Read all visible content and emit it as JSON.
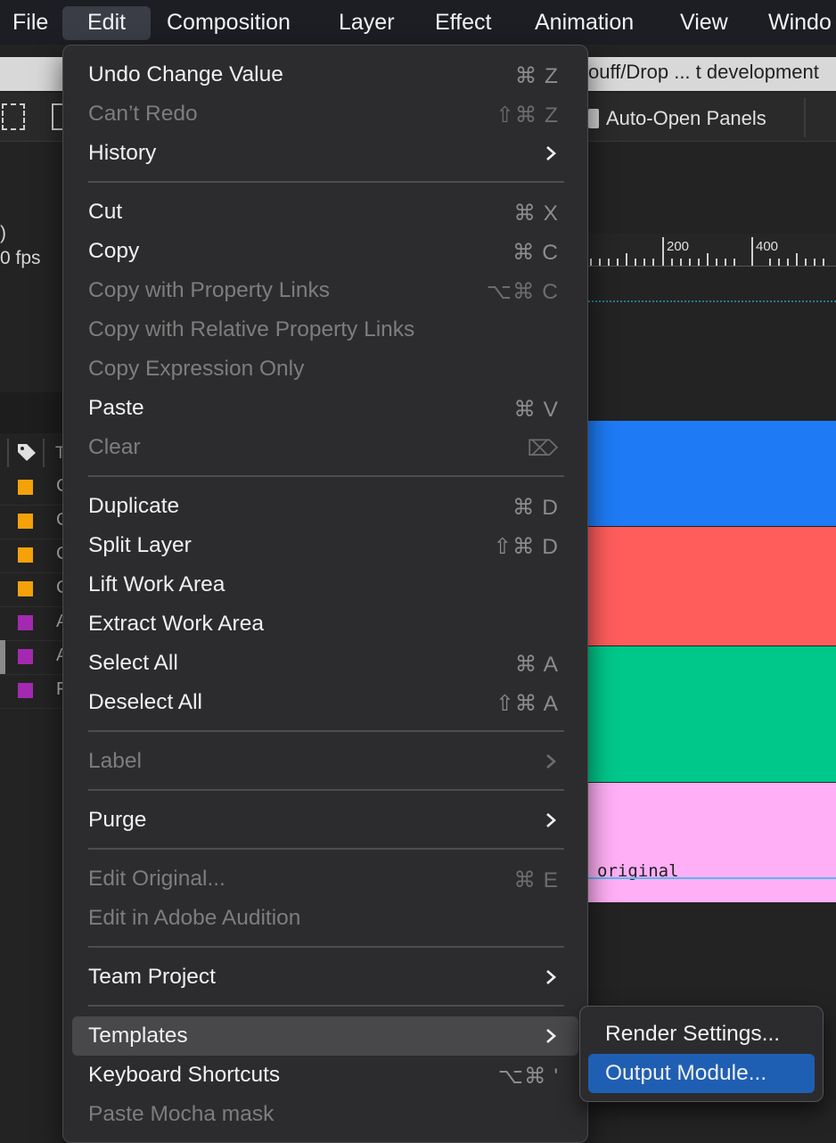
{
  "menubar": {
    "items": [
      "File",
      "Edit",
      "Composition",
      "Layer",
      "Effect",
      "Animation",
      "View",
      "Windo"
    ],
    "active": "Edit"
  },
  "tab": {
    "path": "ouff/Drop ... t development"
  },
  "toolbar": {
    "auto_open_label": "Auto-Open Panels"
  },
  "info": {
    "line1": ")",
    "line2": "0 fps"
  },
  "ruler": {
    "labels": [
      "200",
      "400"
    ]
  },
  "layers": {
    "rows": [
      {
        "color": "#f5a20a",
        "text": "C"
      },
      {
        "color": "#f5a20a",
        "text": "C"
      },
      {
        "color": "#f5a20a",
        "text": "C"
      },
      {
        "color": "#f5a20a",
        "text": "C"
      },
      {
        "color": "#a32ab0",
        "text": "A"
      },
      {
        "color": "#a32ab0",
        "text": "A"
      },
      {
        "color": "#a32ab0",
        "text": "F"
      }
    ],
    "col_header": "T"
  },
  "timeline": {
    "bar_colors": [
      "#1e7bf5",
      "#ff5c5c",
      "#00c78a",
      "#ffaff5"
    ],
    "original_text": "original"
  },
  "edit_menu": {
    "items": [
      {
        "label": "Undo Change Value",
        "shortcut": "⌘ Z",
        "enabled": true
      },
      {
        "label": "Can’t Redo",
        "shortcut": "⇧⌘ Z",
        "enabled": false
      },
      {
        "label": "History",
        "submenu": true,
        "enabled": true
      },
      {
        "label": "Cut",
        "shortcut": "⌘ X",
        "enabled": true
      },
      {
        "label": "Copy",
        "shortcut": "⌘ C",
        "enabled": true
      },
      {
        "label": "Copy with Property Links",
        "shortcut": "⌥⌘ C",
        "enabled": false
      },
      {
        "label": "Copy with Relative Property Links",
        "enabled": false
      },
      {
        "label": "Copy Expression Only",
        "enabled": false
      },
      {
        "label": "Paste",
        "shortcut": "⌘ V",
        "enabled": true
      },
      {
        "label": "Clear",
        "shortcut": "⌦",
        "enabled": false
      },
      {
        "label": "Duplicate",
        "shortcut": "⌘ D",
        "enabled": true
      },
      {
        "label": "Split Layer",
        "shortcut": "⇧⌘ D",
        "enabled": true
      },
      {
        "label": "Lift Work Area",
        "enabled": true
      },
      {
        "label": "Extract Work Area",
        "enabled": true
      },
      {
        "label": "Select All",
        "shortcut": "⌘ A",
        "enabled": true
      },
      {
        "label": "Deselect All",
        "shortcut": "⇧⌘ A",
        "enabled": true
      },
      {
        "label": "Label",
        "submenu": true,
        "enabled": false
      },
      {
        "label": "Purge",
        "submenu": true,
        "enabled": true
      },
      {
        "label": "Edit Original...",
        "shortcut": "⌘ E",
        "enabled": false
      },
      {
        "label": "Edit in Adobe Audition",
        "enabled": false
      },
      {
        "label": "Team Project",
        "submenu": true,
        "enabled": true
      },
      {
        "label": "Templates",
        "submenu": true,
        "enabled": true,
        "highlighted": true
      },
      {
        "label": "Keyboard Shortcuts",
        "shortcut": "⌥⌘ '",
        "enabled": true
      },
      {
        "label": "Paste Mocha mask",
        "enabled": false
      }
    ]
  },
  "templates_submenu": {
    "items": [
      {
        "label": "Render Settings...",
        "selected": false
      },
      {
        "label": "Output Module...",
        "selected": true
      }
    ]
  },
  "colors": {
    "menu_bg": "#2c2c2e",
    "selection_blue": "#1f5fb3",
    "highlight_gray": "#48484a"
  }
}
